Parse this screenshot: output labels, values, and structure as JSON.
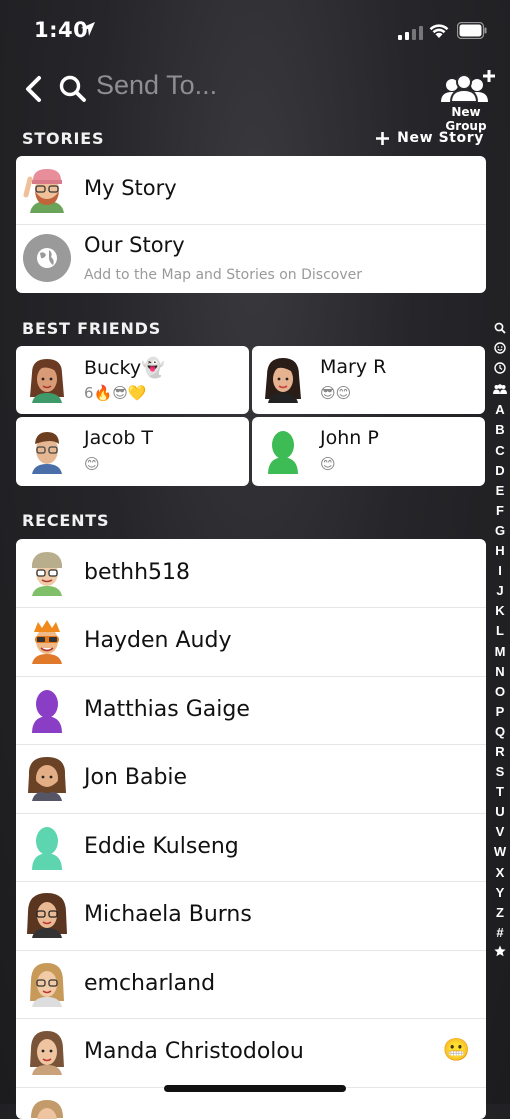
{
  "status_bar": {
    "time": "1:40"
  },
  "header": {
    "search_placeholder": "Send To...",
    "new_group_label": "New Group"
  },
  "stories": {
    "section_label": "STORIES",
    "new_story_label": "New Story",
    "items": [
      {
        "name": "My Story",
        "subtitle": ""
      },
      {
        "name": "Our Story",
        "subtitle": "Add to the Map and Stories on Discover"
      }
    ]
  },
  "best_friends": {
    "section_label": "BEST FRIENDS",
    "items": [
      {
        "name": "Bucky👻",
        "emojis": "6🔥😎💛"
      },
      {
        "name": "Mary R",
        "emojis": "😎😊"
      },
      {
        "name": "Jacob T",
        "emojis": "😊"
      },
      {
        "name": "John P",
        "emojis": "😊"
      }
    ]
  },
  "recents": {
    "section_label": "RECENTS",
    "items": [
      {
        "name": "bethh518",
        "emoji": ""
      },
      {
        "name": "Hayden Audy",
        "emoji": ""
      },
      {
        "name": "Matthias Gaige",
        "emoji": ""
      },
      {
        "name": "Jon Babie",
        "emoji": ""
      },
      {
        "name": "Eddie Kulseng",
        "emoji": ""
      },
      {
        "name": "Michaela Burns",
        "emoji": ""
      },
      {
        "name": "emcharland",
        "emoji": ""
      },
      {
        "name": "Manda Christodolou",
        "emoji": "😬"
      }
    ]
  },
  "alpha_index": [
    "A",
    "B",
    "C",
    "D",
    "E",
    "F",
    "G",
    "H",
    "I",
    "J",
    "K",
    "L",
    "M",
    "N",
    "O",
    "P",
    "Q",
    "R",
    "S",
    "T",
    "U",
    "V",
    "W",
    "X",
    "Y",
    "Z",
    "#"
  ],
  "colors": {
    "matthias_ghost": "#8a3ec6",
    "eddie_ghost": "#5dd6b0",
    "john_ghost": "#3dbb55"
  }
}
